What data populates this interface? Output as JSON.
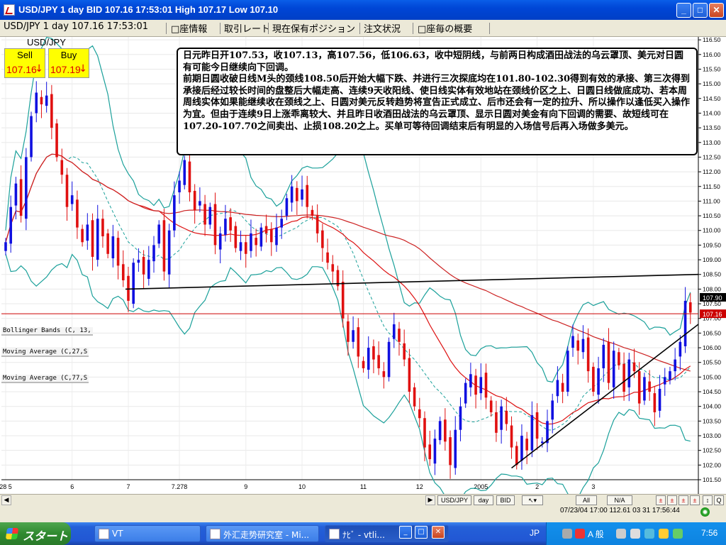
{
  "window": {
    "title": "USD/JPY 1 day BID 107.16 17:53:01 High 107.17 Low 107.10",
    "min": "_",
    "max": "□",
    "close": "✕"
  },
  "tabs": [
    "USD/JPY 1 day 107.16 17:53:01",
    "□座情報",
    "取引レート",
    "現在保有ポジション",
    "注文状況",
    "□座毎の概要"
  ],
  "quote": {
    "pair": "USD/JPY",
    "sell_label": "Sell",
    "sell_price": "107.16",
    "buy_label": "Buy",
    "buy_price": "107.19",
    "arrow": "↓"
  },
  "commentary": "日元昨日开107.53，收107.13，高107.56，低106.63，收中短阴线，与前两日构成酒田战法的乌云罩顶、美元对日圆有可能今日继续向下回调。\n前期日圆收破日线M头的颈线108.50后开始大幅下跌、并进行三次探底均在101.80-102.30得到有效的承接、第三次得到承接后经过较长时间的盘整后大幅走高、连续9天收阳线、使日线实体有效地站在颈线价区之上、日圆日线做底成功、若本周周线实体如果能继续收在颈线之上、日圆对美元反转趋势将宣告正式成立、后市还会有一定的拉升、所以操作以逢低买入操作为宜。但由于连续9日上涨乖离较大、并且昨日收酒田战法的乌云罩顶、显示日圆对美金有向下回调的需要、故短线可在107.20-107.70之间卖出、止损108.20之上。买单可等待回调结束后有明显的入场信号后再入场做多美元。",
  "indicators": [
    "Bollinger Bands (C, 13,",
    "Moving Average (C,27,S",
    "Moving Average (C,77,S"
  ],
  "bottom": {
    "buttons": [
      "USD/JPY",
      "day",
      "BID",
      "All",
      "N/A"
    ],
    "status": "07/23/04 17:00  112.61 03 31 17:56:44"
  },
  "taskbar": {
    "start": "スタート",
    "tasks": [
      "VT",
      "外汇走势研究室 - Mi...",
      "ﾅﾋﾞ - vtli..."
    ],
    "lang": "JP",
    "ime": "A 般",
    "clock": "7:56"
  },
  "colors": {
    "bull": "#1010e0",
    "bear": "#e01010",
    "bb": "#1aa09a",
    "ma27": "#dd1111",
    "ma77": "#cc2222",
    "last_price_line": "#cc0000"
  },
  "chart_data": {
    "type": "candlestick",
    "symbol": "USD/JPY",
    "timeframe": "1 day",
    "ylim": [
      101.5,
      116.6
    ],
    "y_ticks": [
      "116.50",
      "116.00",
      "115.50",
      "115.00",
      "114.50",
      "114.00",
      "113.50",
      "113.00",
      "112.50",
      "112.00",
      "111.50",
      "111.00",
      "110.50",
      "110.00",
      "109.50",
      "109.00",
      "108.50",
      "108.00",
      "107.50",
      "107.00",
      "106.50",
      "106.00",
      "105.50",
      "105.00",
      "104.50",
      "104.00",
      "103.50",
      "103.00",
      "102.50",
      "102.00",
      "101.50"
    ],
    "x_ticks": [
      {
        "label": "28 5",
        "i": 0
      },
      {
        "label": "6",
        "i": 13
      },
      {
        "label": "7",
        "i": 24
      },
      {
        "label": "7.278",
        "i": 34
      },
      {
        "label": "9",
        "i": 47
      },
      {
        "label": "10",
        "i": 58
      },
      {
        "label": "11",
        "i": 70
      },
      {
        "label": "12",
        "i": 81
      },
      {
        "label": "2005",
        "i": 93
      },
      {
        "label": "2",
        "i": 104
      },
      {
        "label": "3",
        "i": 115
      }
    ],
    "last_price": "107.16",
    "last_price_value": 107.16,
    "last_label_high": "107.90",
    "last_label_high_value": 107.72,
    "closes": [
      109.6,
      110.8,
      111.6,
      110.5,
      112.5,
      113.9,
      114.7,
      114.3,
      114.6,
      113.5,
      112.5,
      111.9,
      110.8,
      111.2,
      110.1,
      109.6,
      110.2,
      109.1,
      110.4,
      109.8,
      109.2,
      109.8,
      108.8,
      108.3,
      107.6,
      108.9,
      109.0,
      108.5,
      109.0,
      109.5,
      110.2,
      108.6,
      110.0,
      111.2,
      111.7,
      112.4,
      111.3,
      110.7,
      111.0,
      110.2,
      110.8,
      109.5,
      109.9,
      110.4,
      110.0,
      109.4,
      109.6,
      109.2,
      109.9,
      109.5,
      110.1,
      109.9,
      109.6,
      110.1,
      110.4,
      111.1,
      111.5,
      111.0,
      111.4,
      110.8,
      110.5,
      109.9,
      109.4,
      108.9,
      108.6,
      108.1,
      107.0,
      106.2,
      106.6,
      105.7,
      105.3,
      106.0,
      105.6,
      105.3,
      105.0,
      106.2,
      106.8,
      106.2,
      105.6,
      104.5,
      104.0,
      103.6,
      102.6,
      102.2,
      102.9,
      103.5,
      102.8,
      102.0,
      103.2,
      104.0,
      104.8,
      105.1,
      104.4,
      105.0,
      104.3,
      103.8,
      103.1,
      104.0,
      103.4,
      102.6,
      102.0,
      103.0,
      102.5,
      103.7,
      102.9,
      102.8,
      103.5,
      104.2,
      104.9,
      104.5,
      105.9,
      106.4,
      105.9,
      106.3,
      105.2,
      104.5,
      105.3,
      106.1,
      104.8,
      105.9,
      105.4,
      104.5,
      105.6,
      105.2,
      104.1,
      105.0,
      104.5,
      103.8,
      104.6,
      105.0,
      105.2,
      105.6,
      106.2,
      107.6,
      107.2
    ]
  }
}
